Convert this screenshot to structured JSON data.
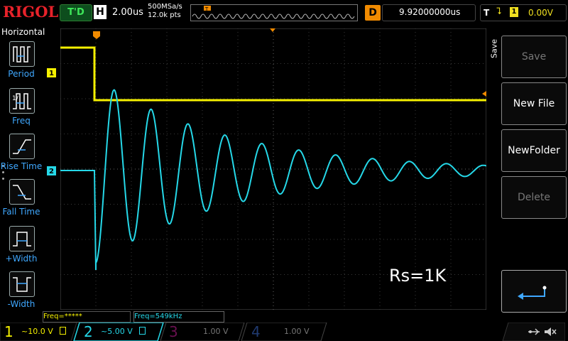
{
  "header": {
    "brand": "RIGOL",
    "run_state": "T'D",
    "horizontal_label": "H",
    "timebase": "2.00us",
    "sample_rate": "500MSa/s",
    "memory_depth": "12.0k pts",
    "trigger_marker": "T",
    "delay_label": "D",
    "delay_value": "9.92000000us",
    "trigger_label": "T",
    "trigger_edge": "⮧",
    "trigger_source": "1",
    "trigger_level": "0.00V"
  },
  "left_menu": {
    "title": "Horizontal",
    "items": [
      {
        "label": "Period",
        "icon": "period-icon"
      },
      {
        "label": "Freq",
        "icon": "freq-icon"
      },
      {
        "label": "Rise Time",
        "icon": "rise-time-icon"
      },
      {
        "label": "Fall Time",
        "icon": "fall-time-icon"
      },
      {
        "label": "+Width",
        "icon": "positive-width-icon"
      },
      {
        "label": "-Width",
        "icon": "negative-width-icon"
      }
    ]
  },
  "right_menu": {
    "section": "Save",
    "buttons": [
      {
        "label": "Save",
        "enabled": false
      },
      {
        "label": "New File",
        "enabled": true
      },
      {
        "label": "NewFolder",
        "enabled": true
      },
      {
        "label": "Delete",
        "enabled": false
      },
      {
        "label": "",
        "icon": "enter-icon",
        "enabled": true
      }
    ]
  },
  "measurements": {
    "freq1": "Freq=*****",
    "freq2": "Freq=549kHz"
  },
  "annotation": "Rs=1K",
  "channels": [
    {
      "num": "1",
      "scale": "10.0 V",
      "color": "#f5f000",
      "active": true
    },
    {
      "num": "2",
      "scale": "5.00 V",
      "color": "#25d8e8",
      "active": true
    },
    {
      "num": "3",
      "scale": "1.00 V",
      "color": "#c01890",
      "active": false
    },
    {
      "num": "4",
      "scale": "1.00 V",
      "color": "#2a58b8",
      "active": false
    }
  ],
  "channel_markers": [
    "1",
    "2"
  ],
  "colors": {
    "ch1": "#f5f000",
    "ch2": "#25d8e8",
    "trigger": "#f08a00",
    "menu_label": "#3fa8ff"
  }
}
